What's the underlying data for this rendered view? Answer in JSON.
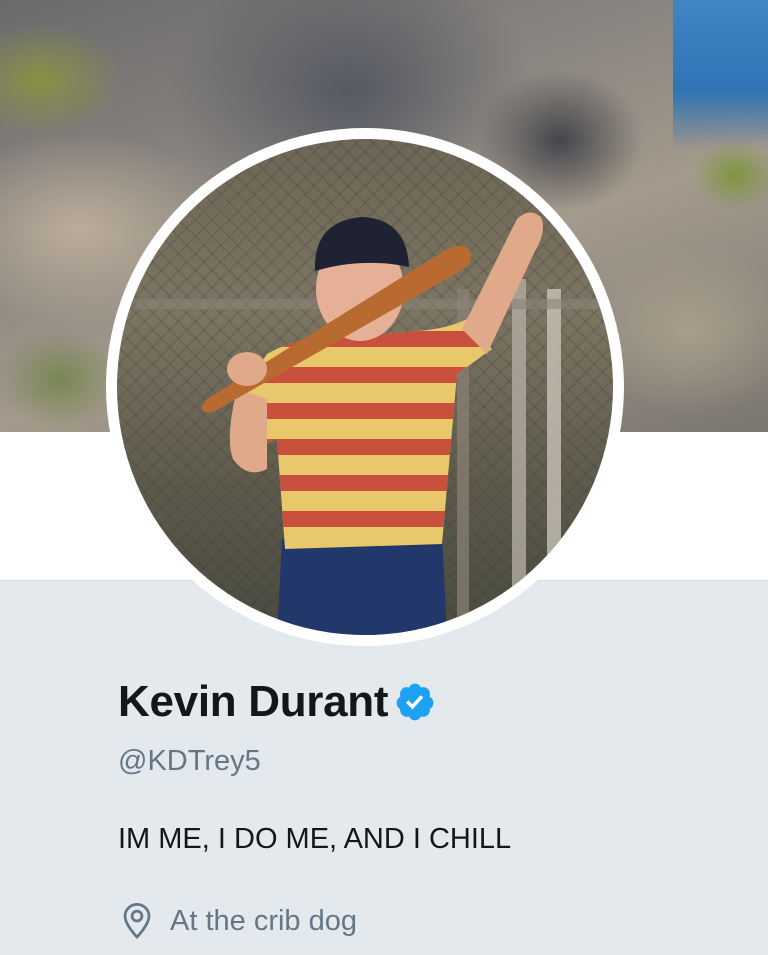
{
  "profile": {
    "display_name": "Kevin Durant",
    "verified_icon": "verified-badge-icon",
    "handle": "@KDTrey5",
    "bio": "IM ME, I DO ME, AND I CHILL",
    "location": "At the crib dog",
    "location_icon": "location-pin-icon"
  },
  "colors": {
    "verified_blue": "#1da1f2",
    "name_text": "#14171a",
    "secondary_text": "#657786",
    "panel_bg": "#e4e9ee"
  }
}
